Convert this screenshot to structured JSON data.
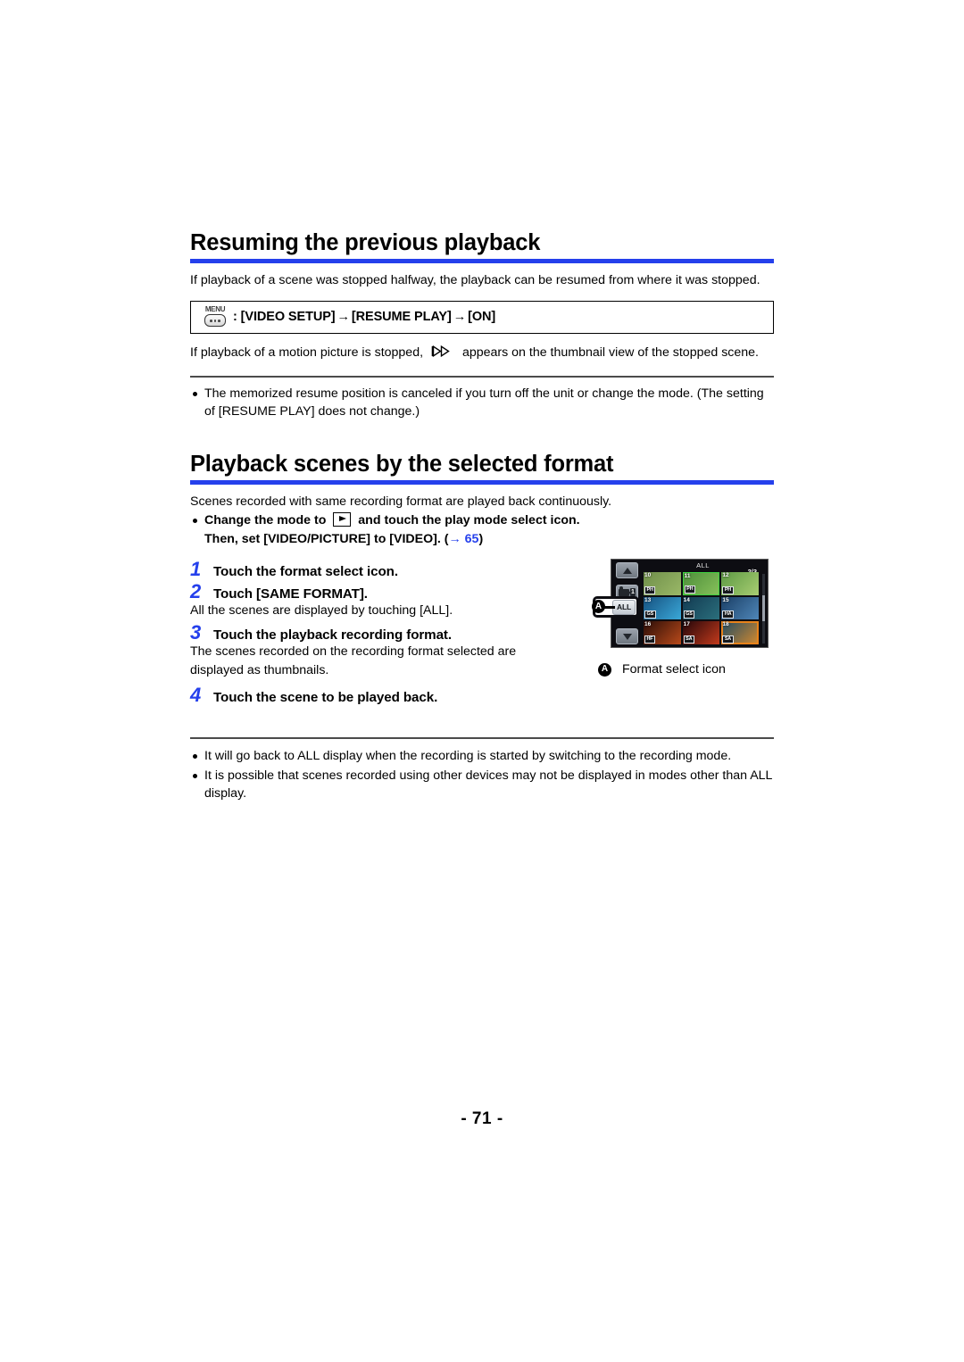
{
  "doc": {
    "page_number": "- 71 -"
  },
  "section1": {
    "title": "Resuming the previous playback",
    "intro": "If playback of a scene was stopped halfway, the playback can be resumed from where it was stopped.",
    "menu_icon_label": "MENU",
    "menu_path_prefix": ": [VIDEO SETUP]",
    "menu_path_item2": "[RESUME PLAY]",
    "menu_path_item3": "[ON]",
    "menu_arrow": "→",
    "after_text_1": "If playback of a motion picture is stopped,",
    "resume_icon_name": "resume-playback-icon",
    "after_text_2": "appears on the thumbnail view of the stopped scene.",
    "notes": [
      "The memorized resume position is canceled if you turn off the unit or change the mode. (The setting of [RESUME PLAY] does not change.)"
    ]
  },
  "section2": {
    "title": "Playback scenes by the selected format",
    "intro": "Scenes recorded with same recording format are played back continuously.",
    "prereq_part1": "Change the mode to",
    "prereq_part2": "and touch the play mode select icon.",
    "prereq_line2_a": "Then, set [VIDEO/PICTURE] to [VIDEO]. (",
    "prereq_arrow": "→",
    "prereq_page_ref": "65",
    "prereq_line2_b": ")",
    "steps": [
      {
        "num": "1",
        "title": "Touch the format select icon.",
        "note": ""
      },
      {
        "num": "2",
        "title": "Touch [SAME FORMAT].",
        "note": "All the scenes are displayed by touching [ALL]."
      },
      {
        "num": "3",
        "title": "Touch the playback recording format.",
        "note": "The scenes recorded on the recording format selected are displayed as thumbnails."
      },
      {
        "num": "4",
        "title": "Touch the scene to be played back.",
        "note": ""
      }
    ],
    "notes": [
      "It will go back to ALL display when the recording is started by switching to the recording mode.",
      "It is possible that scenes recorded using other devices may not be displayed in modes other than ALL display."
    ]
  },
  "illustration": {
    "callout_letter": "A",
    "caption_letter": "A",
    "caption_text": "Format select icon",
    "screen": {
      "header_label": "ALL",
      "page_indicator": "2/3",
      "all_button_label": "ALL",
      "camcorder_badge": "1",
      "up_arrow_name": "scroll-up-button",
      "down_arrow_name": "scroll-down-button",
      "thumbnails": [
        {
          "num": "10",
          "badge": "PH",
          "color1": "#6f8f4a",
          "color2": "#9ab867",
          "selected": false,
          "green_border": false
        },
        {
          "num": "11",
          "badge": "PH",
          "color1": "#4e8e3b",
          "color2": "#86c05a",
          "selected": false,
          "green_border": true
        },
        {
          "num": "12",
          "badge": "PH",
          "color1": "#5d9a44",
          "color2": "#a8cd72",
          "selected": false,
          "green_border": false
        },
        {
          "num": "13",
          "badge": "GS",
          "color1": "#15507f",
          "color2": "#3aa8d8",
          "selected": false,
          "green_border": false
        },
        {
          "num": "14",
          "badge": "GS",
          "color1": "#123a52",
          "color2": "#2b6f7c",
          "selected": false,
          "green_border": false
        },
        {
          "num": "15",
          "badge": "HA",
          "color1": "#1a3f66",
          "color2": "#4f86b8",
          "selected": false,
          "green_border": false
        },
        {
          "num": "16",
          "badge": "HF",
          "color1": "#2a0d07",
          "color2": "#b8491a",
          "selected": false,
          "green_border": false
        },
        {
          "num": "17",
          "badge": "SA",
          "color1": "#24060a",
          "color2": "#c23a1c",
          "selected": false,
          "green_border": false
        },
        {
          "num": "18",
          "badge": "SA",
          "color1": "#1d4a63",
          "color2": "#d68a2e",
          "selected": true,
          "green_border": false
        }
      ]
    }
  },
  "colors": {
    "accent_blue": "#2540ec",
    "selection_orange": "#e8821a",
    "rule_gray": "#4b4b4b"
  }
}
